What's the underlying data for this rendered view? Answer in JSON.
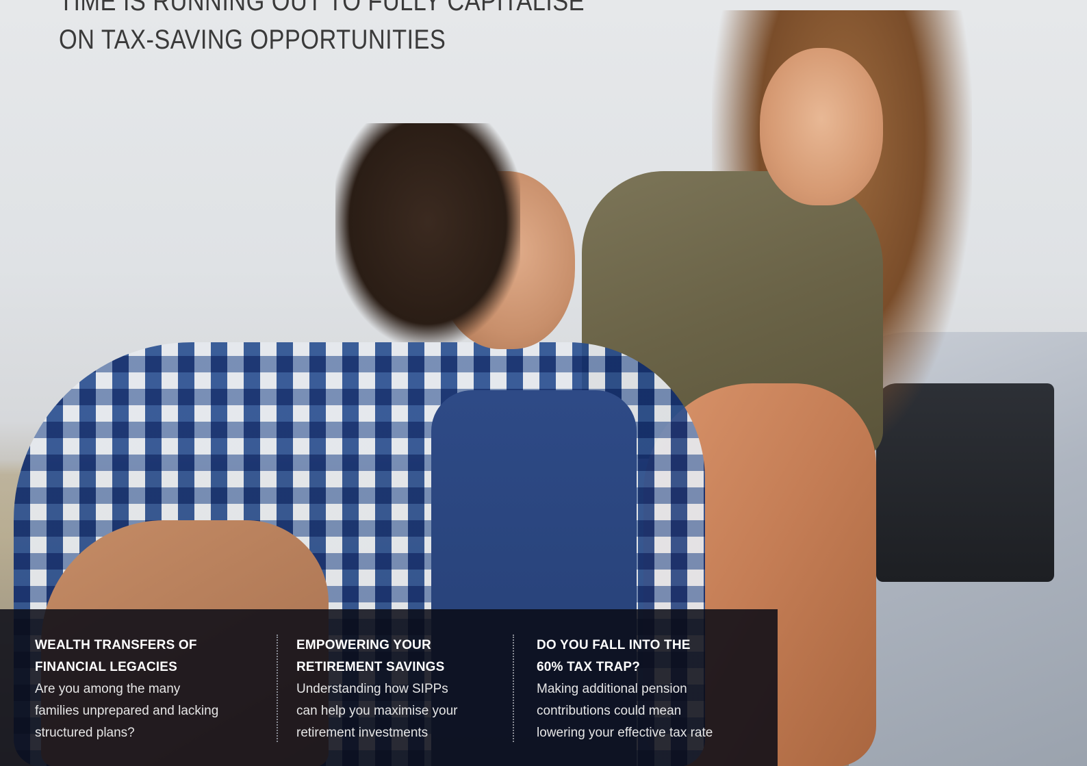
{
  "headline": {
    "line1": "TIME IS RUNNING OUT TO FULLY CAPITALISE",
    "line2": "ON TAX-SAVING OPPORTUNITIES"
  },
  "cards": [
    {
      "title_line1": "WEALTH TRANSFERS OF",
      "title_line2": "FINANCIAL LEGACIES",
      "text_line1": "Are you among the many",
      "text_line2": "families unprepared and lacking",
      "text_line3": "structured plans?"
    },
    {
      "title_line1": "EMPOWERING YOUR",
      "title_line2": "RETIREMENT SAVINGS",
      "text_line1": "Understanding how SIPPs",
      "text_line2": "can help you maximise your",
      "text_line3": "retirement investments"
    },
    {
      "title_line1": "DO YOU FALL INTO THE",
      "title_line2": "60% TAX TRAP?",
      "text_line1": "Making additional pension",
      "text_line2": "contributions could mean",
      "text_line3": "lowering your effective tax rate"
    }
  ]
}
